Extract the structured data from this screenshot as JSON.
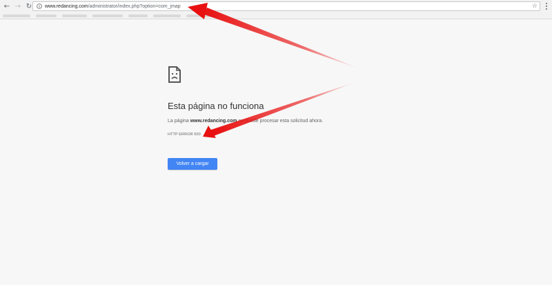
{
  "browser": {
    "url_prefix": "www.redancing.com",
    "url_rest": "/administrator/index.php?option=com_jmap",
    "icons": {
      "back": "back-arrow-icon",
      "forward": "forward-arrow-icon",
      "reload": "reload-icon",
      "site": "page-info-icon",
      "bookmark": "star-icon",
      "menu": "more-vert-icon"
    }
  },
  "error_page": {
    "icon": "sad-page-icon",
    "title": "Esta página no funciona",
    "description_prefix": "La página ",
    "description_host": "www.redancing.com",
    "description_suffix": " no puede procesar esta solicitud ahora.",
    "error_code": "HTTP ERROR 500",
    "reload_label": "Volver a cargar"
  },
  "annotations": {
    "arrow_color": "#e81010",
    "arrows": [
      "url-annotation-arrow",
      "error-code-annotation-arrow"
    ]
  },
  "colors": {
    "button_blue": "#4285f4",
    "page_bg": "#f7f7f7"
  }
}
